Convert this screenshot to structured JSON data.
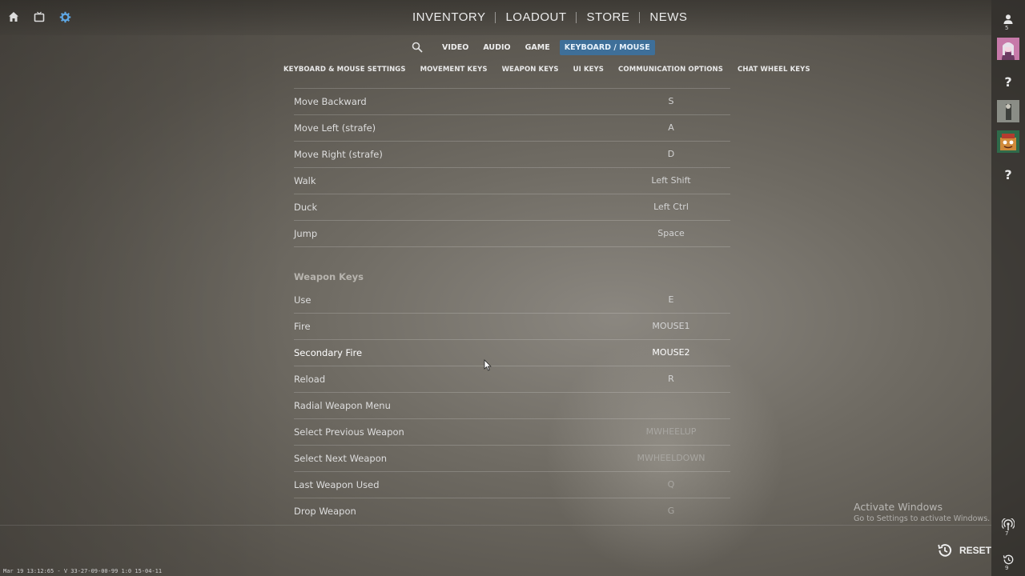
{
  "colors": {
    "accent": "#5fa8e6",
    "active_tab_bg": "#3e6f99"
  },
  "top_left_icons": [
    "home-icon",
    "tv-icon",
    "gear-icon"
  ],
  "main_nav": [
    "INVENTORY",
    "LOADOUT",
    "STORE",
    "NEWS"
  ],
  "settings_tabs": [
    {
      "label": "VIDEO",
      "active": false
    },
    {
      "label": "AUDIO",
      "active": false
    },
    {
      "label": "GAME",
      "active": false
    },
    {
      "label": "KEYBOARD / MOUSE",
      "active": true
    }
  ],
  "section_tabs": [
    "KEYBOARD & MOUSE SETTINGS",
    "MOVEMENT KEYS",
    "WEAPON KEYS",
    "UI KEYS",
    "COMMUNICATION OPTIONS",
    "CHAT WHEEL KEYS"
  ],
  "movement_rows": [
    {
      "action": "Move Backward",
      "key": "S"
    },
    {
      "action": "Move Left (strafe)",
      "key": "A"
    },
    {
      "action": "Move Right (strafe)",
      "key": "D"
    },
    {
      "action": "Walk",
      "key": "Left Shift"
    },
    {
      "action": "Duck",
      "key": "Left Ctrl"
    },
    {
      "action": "Jump",
      "key": "Space"
    }
  ],
  "weapon_section_title": "Weapon Keys",
  "weapon_rows": [
    {
      "action": "Use",
      "key": "E"
    },
    {
      "action": "Fire",
      "key": "MOUSE1"
    },
    {
      "action": "Secondary Fire",
      "key": "MOUSE2"
    },
    {
      "action": "Reload",
      "key": "R"
    },
    {
      "action": "Radial Weapon Menu",
      "key": ""
    },
    {
      "action": "Select Previous Weapon",
      "key": "MWHEELUP"
    },
    {
      "action": "Select Next Weapon",
      "key": "MWHEELDOWN"
    },
    {
      "action": "Last Weapon Used",
      "key": "Q"
    },
    {
      "action": "Drop Weapon",
      "key": "G"
    }
  ],
  "right_sidebar": {
    "friends_count": "5",
    "bottom_counts": [
      "7",
      "9"
    ]
  },
  "reset_label": "RESET",
  "activate_windows": {
    "title": "Activate Windows",
    "subtitle": "Go to Settings to activate Windows."
  },
  "version_text": "Mar 19 13:12:65 - V 33-27-09-00-99 1:0 15-04-11"
}
